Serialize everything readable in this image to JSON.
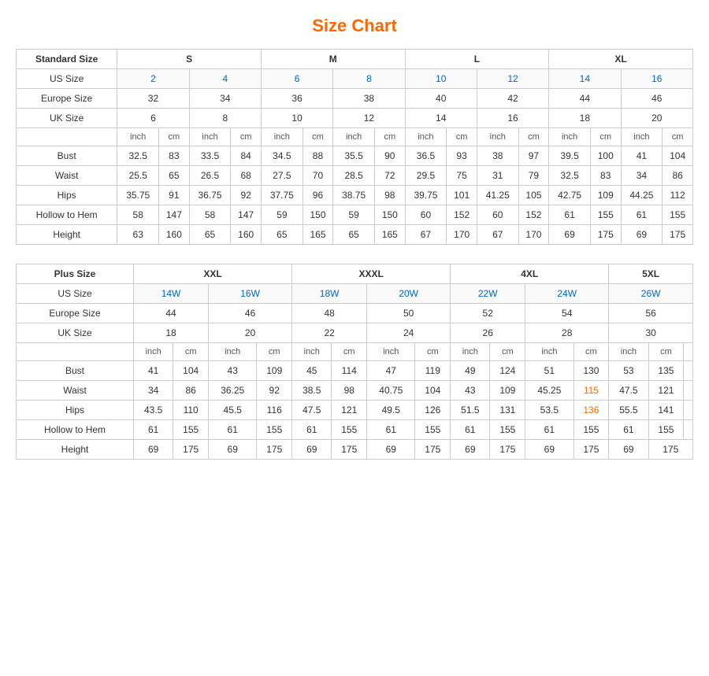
{
  "title": "Size Chart",
  "table1": {
    "title": "Standard Size",
    "groups": [
      "S",
      "M",
      "L",
      "XL"
    ],
    "groupCols": [
      2,
      2,
      2,
      2
    ],
    "rows": {
      "usSize": {
        "label": "US Size",
        "values": [
          "2",
          "4",
          "6",
          "8",
          "10",
          "12",
          "14",
          "16"
        ]
      },
      "europeSize": {
        "label": "Europe Size",
        "values": [
          "32",
          "34",
          "36",
          "38",
          "40",
          "42",
          "44",
          "46"
        ]
      },
      "ukSize": {
        "label": "UK Size",
        "values": [
          "6",
          "8",
          "10",
          "12",
          "14",
          "16",
          "18",
          "20"
        ]
      },
      "units": [
        "inch",
        "cm",
        "inch",
        "cm",
        "inch",
        "cm",
        "inch",
        "cm",
        "inch",
        "cm",
        "inch",
        "cm",
        "inch",
        "cm",
        "inch",
        "cm"
      ],
      "bust": {
        "label": "Bust",
        "values": [
          "32.5",
          "83",
          "33.5",
          "84",
          "34.5",
          "88",
          "35.5",
          "90",
          "36.5",
          "93",
          "38",
          "97",
          "39.5",
          "100",
          "41",
          "104"
        ]
      },
      "waist": {
        "label": "Waist",
        "values": [
          "25.5",
          "65",
          "26.5",
          "68",
          "27.5",
          "70",
          "28.5",
          "72",
          "29.5",
          "75",
          "31",
          "79",
          "32.5",
          "83",
          "34",
          "86"
        ]
      },
      "hips": {
        "label": "Hips",
        "values": [
          "35.75",
          "91",
          "36.75",
          "92",
          "37.75",
          "96",
          "38.75",
          "98",
          "39.75",
          "101",
          "41.25",
          "105",
          "42.75",
          "109",
          "44.25",
          "112"
        ]
      },
      "hollowToHem": {
        "label": "Hollow to Hem",
        "values": [
          "58",
          "147",
          "58",
          "147",
          "59",
          "150",
          "59",
          "150",
          "60",
          "152",
          "60",
          "152",
          "61",
          "155",
          "61",
          "155"
        ]
      },
      "height": {
        "label": "Height",
        "values": [
          "63",
          "160",
          "65",
          "160",
          "65",
          "165",
          "65",
          "165",
          "67",
          "170",
          "67",
          "170",
          "69",
          "175",
          "69",
          "175"
        ]
      }
    }
  },
  "table2": {
    "title": "Plus Size",
    "groups": [
      "XXL",
      "XXXL",
      "4XL",
      "5XL"
    ],
    "groupCols": [
      2,
      2,
      2,
      1
    ],
    "rows": {
      "usSize": {
        "label": "US Size",
        "values": [
          "14W",
          "16W",
          "18W",
          "20W",
          "22W",
          "24W",
          "26W"
        ]
      },
      "europeSize": {
        "label": "Europe Size",
        "values": [
          "44",
          "46",
          "48",
          "50",
          "52",
          "54",
          "56"
        ]
      },
      "ukSize": {
        "label": "UK Size",
        "values": [
          "18",
          "20",
          "22",
          "24",
          "26",
          "28",
          "30"
        ]
      },
      "units": [
        "inch",
        "cm",
        "inch",
        "cm",
        "inch",
        "cm",
        "inch",
        "cm",
        "inch",
        "cm",
        "inch",
        "cm",
        "inch",
        "cm"
      ],
      "bust": {
        "label": "Bust",
        "values": [
          "41",
          "104",
          "43",
          "109",
          "45",
          "114",
          "47",
          "119",
          "49",
          "124",
          "51",
          "130",
          "53",
          "135"
        ]
      },
      "waist": {
        "label": "Waist",
        "values": [
          "34",
          "86",
          "36.25",
          "92",
          "38.5",
          "98",
          "40.75",
          "104",
          "43",
          "109",
          "45.25",
          "115",
          "47.5",
          "121"
        ]
      },
      "hips": {
        "label": "Hips",
        "values": [
          "43.5",
          "110",
          "45.5",
          "116",
          "47.5",
          "121",
          "49.5",
          "126",
          "51.5",
          "131",
          "53.5",
          "136",
          "55.5",
          "141"
        ]
      },
      "hollowToHem": {
        "label": "Hollow to Hem",
        "values": [
          "61",
          "155",
          "61",
          "155",
          "61",
          "155",
          "61",
          "155",
          "61",
          "155",
          "61",
          "155",
          "61",
          "155"
        ]
      },
      "height": {
        "label": "Height",
        "values": [
          "69",
          "175",
          "69",
          "175",
          "69",
          "175",
          "69",
          "175",
          "69",
          "175",
          "69",
          "175",
          "69",
          "175"
        ]
      }
    }
  }
}
